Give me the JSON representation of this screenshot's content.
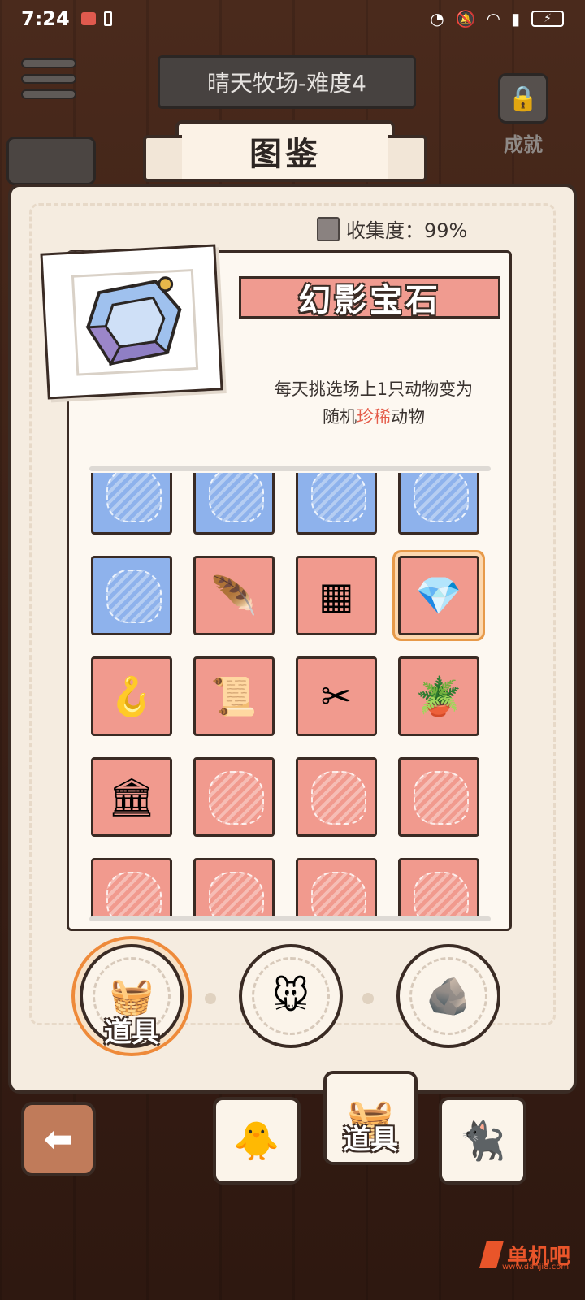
{
  "status_bar": {
    "time": "7:24"
  },
  "header": {
    "level_title": "晴天牧场-难度4",
    "achievement_label": "成就",
    "book_title": "图鉴"
  },
  "collection": {
    "label": "收集度：99%"
  },
  "detail": {
    "name": "幻影宝石",
    "desc_line1": "每天挑选场上1只动物变为",
    "desc_line2_prefix": "随机",
    "desc_line2_highlight": "珍稀",
    "desc_line2_suffix": "动物"
  },
  "grid": {
    "rows": [
      [
        {
          "kind": "blue",
          "item": "unknown"
        },
        {
          "kind": "blue",
          "item": "unknown"
        },
        {
          "kind": "blue",
          "item": "unknown"
        },
        {
          "kind": "blue",
          "item": "unknown"
        }
      ],
      [
        {
          "kind": "blue",
          "item": "unknown"
        },
        {
          "kind": "red",
          "item": "feather-icon"
        },
        {
          "kind": "red",
          "item": "tray-icon"
        },
        {
          "kind": "red",
          "item": "gem-icon",
          "selected": true
        }
      ],
      [
        {
          "kind": "red",
          "item": "hanger-icon"
        },
        {
          "kind": "red",
          "item": "scroll-icon"
        },
        {
          "kind": "red",
          "item": "scissors-icon"
        },
        {
          "kind": "red",
          "item": "plant-jar-icon"
        }
      ],
      [
        {
          "kind": "red",
          "item": "birdcage-icon"
        },
        {
          "kind": "red",
          "item": "unknown"
        },
        {
          "kind": "red",
          "item": "unknown"
        },
        {
          "kind": "red",
          "item": "unknown"
        }
      ],
      [
        {
          "kind": "red",
          "item": "unknown"
        },
        {
          "kind": "red",
          "item": "unknown"
        },
        {
          "kind": "red",
          "item": "unknown"
        },
        {
          "kind": "red",
          "item": "unknown"
        }
      ]
    ]
  },
  "category_tabs": [
    {
      "name": "basket-icon",
      "label": "道具",
      "active": true
    },
    {
      "name": "hamster-icon",
      "label": "",
      "active": false
    },
    {
      "name": "stones-icon",
      "label": "",
      "active": false
    }
  ],
  "bottom_tabs": [
    {
      "name": "chick-icon",
      "label": ""
    },
    {
      "name": "basket-icon",
      "label": "道具"
    },
    {
      "name": "cat-icon",
      "label": ""
    }
  ],
  "watermark": {
    "text": "单机吧",
    "url": "www.danji8.com"
  }
}
